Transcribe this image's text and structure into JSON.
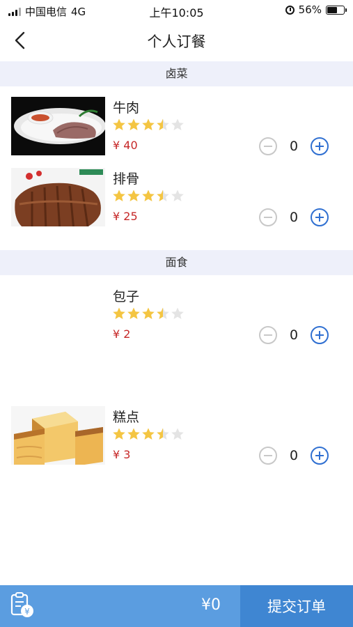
{
  "status_bar": {
    "carrier": "中国电信",
    "network": "4G",
    "time": "上午10:05",
    "battery": "56%"
  },
  "nav": {
    "title": "个人订餐",
    "back_icon": "chevron-left-icon"
  },
  "categories": [
    {
      "name": "卤菜",
      "items": [
        {
          "name": "牛肉",
          "price": "¥ 40",
          "rating": 3.5,
          "quantity": "0"
        },
        {
          "name": "排骨",
          "price": "¥ 25",
          "rating": 3.5,
          "quantity": "0"
        }
      ]
    },
    {
      "name": "面食",
      "items": [
        {
          "name": "包子",
          "price": "¥ 2",
          "rating": 3.5,
          "quantity": "0"
        },
        {
          "name": "糕点",
          "price": "¥ 3",
          "rating": 3.5,
          "quantity": "0"
        }
      ]
    }
  ],
  "bottom_bar": {
    "total": "¥0",
    "submit_label": "提交订单",
    "cart_icon": "order-receipt-icon"
  },
  "colors": {
    "accent": "#2f6fd1",
    "price": "#c62828",
    "star": "#f4c542",
    "bottom_bar": "#5b9de0",
    "submit": "#3f86d2",
    "category_bg": "#eef0fa"
  }
}
